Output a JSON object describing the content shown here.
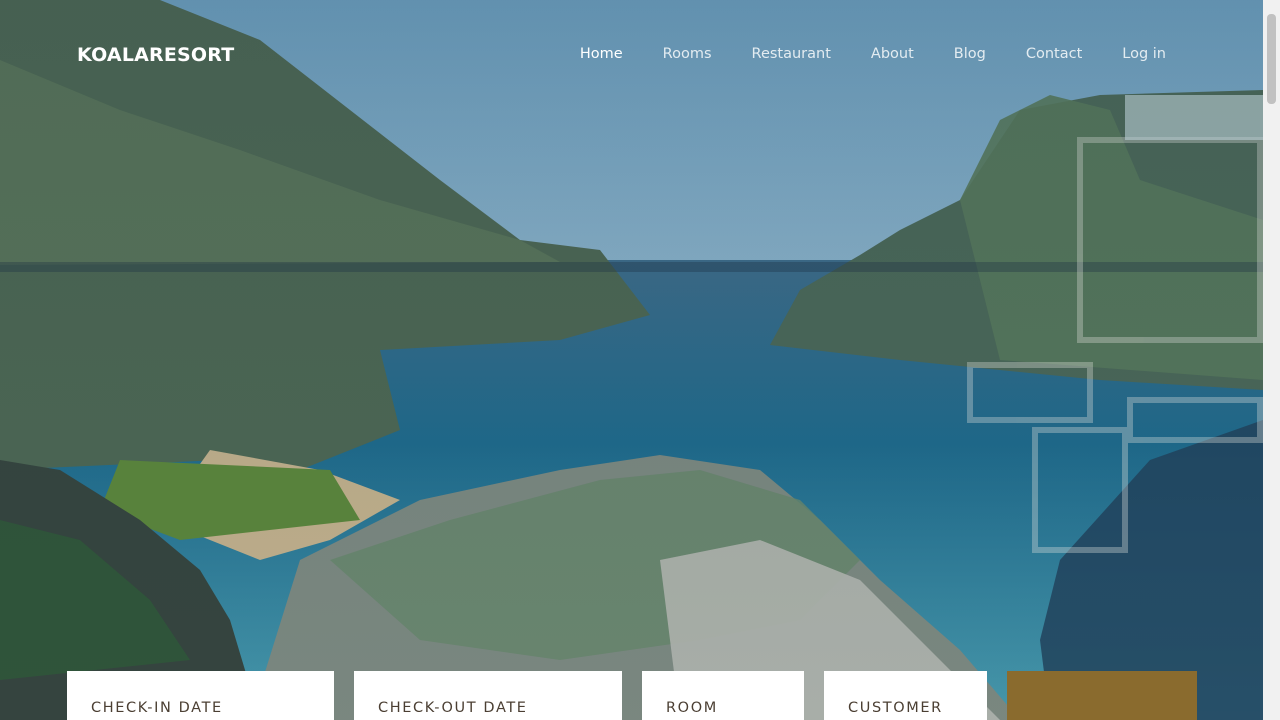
{
  "brand": "KOALARESORT",
  "nav": {
    "home": "Home",
    "rooms": "Rooms",
    "restaurant": "Restaurant",
    "about": "About",
    "blog": "Blog",
    "contact": "Contact",
    "login": "Log in"
  },
  "booking": {
    "checkin_label": "CHECK-IN DATE",
    "checkout_label": "CHECK-OUT DATE",
    "room_label": "ROOM",
    "customer_label": "CUSTOMER"
  },
  "colors": {
    "accent": "#8a6b2e",
    "label": "#4b3f33"
  }
}
